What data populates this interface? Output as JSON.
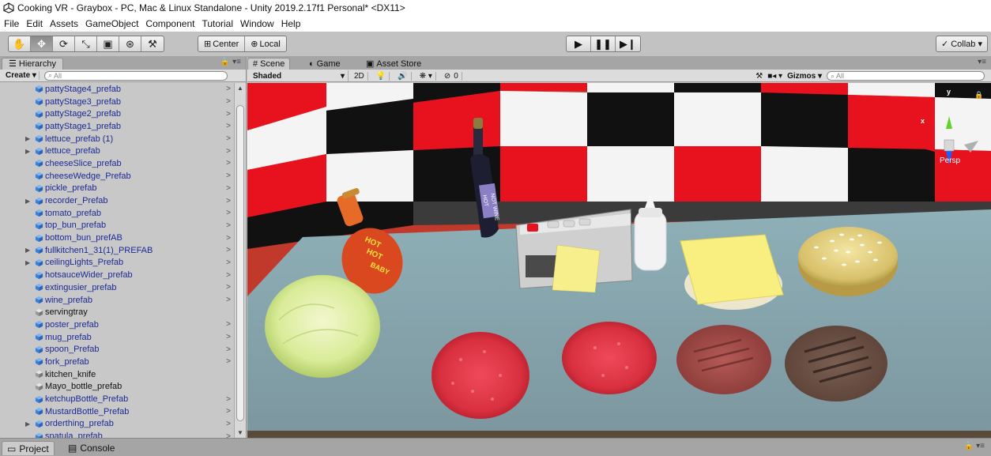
{
  "window": {
    "title": "Cooking VR - Graybox - PC, Mac & Linux Standalone - Unity 2019.2.17f1 Personal* <DX11>"
  },
  "menu": [
    "File",
    "Edit",
    "Assets",
    "GameObject",
    "Component",
    "Tutorial",
    "Window",
    "Help"
  ],
  "toolbar": {
    "tools": [
      "hand-tool",
      "move-tool",
      "rotate-tool",
      "scale-tool",
      "rect-tool",
      "transform-tool",
      "custom-tool"
    ],
    "active_tool": "move-tool",
    "pivot_label": "Center",
    "space_label": "Local",
    "collab_label": "Collab ▾"
  },
  "hierarchy": {
    "tab_label": "Hierarchy",
    "create_label": "Create ▾",
    "search_placeholder": "All",
    "items": [
      {
        "label": "pattyStage4_prefab",
        "expandable": false,
        "chevron": true,
        "prefab": true
      },
      {
        "label": "pattyStage3_prefab",
        "expandable": false,
        "chevron": true,
        "prefab": true
      },
      {
        "label": "pattyStage2_prefab",
        "expandable": false,
        "chevron": true,
        "prefab": true
      },
      {
        "label": "pattyStage1_prefab",
        "expandable": false,
        "chevron": true,
        "prefab": true
      },
      {
        "label": "lettuce_prefab (1)",
        "expandable": true,
        "chevron": true,
        "prefab": true
      },
      {
        "label": "lettuce_prefab",
        "expandable": true,
        "chevron": true,
        "prefab": true
      },
      {
        "label": "cheeseSlice_prefab",
        "expandable": false,
        "chevron": true,
        "prefab": true
      },
      {
        "label": "cheeseWedge_Prefab",
        "expandable": false,
        "chevron": true,
        "prefab": true
      },
      {
        "label": "pickle_prefab",
        "expandable": false,
        "chevron": true,
        "prefab": true
      },
      {
        "label": "recorder_Prefab",
        "expandable": true,
        "chevron": true,
        "prefab": true
      },
      {
        "label": "tomato_prefab",
        "expandable": false,
        "chevron": true,
        "prefab": true
      },
      {
        "label": "top_bun_prefab",
        "expandable": false,
        "chevron": true,
        "prefab": true
      },
      {
        "label": "bottom_bun_prefAB",
        "expandable": false,
        "chevron": true,
        "prefab": true
      },
      {
        "label": "fullkitchen1_31(1)_PREFAB",
        "expandable": true,
        "chevron": true,
        "prefab": true
      },
      {
        "label": "ceilingLights_Prefab",
        "expandable": true,
        "chevron": true,
        "prefab": true
      },
      {
        "label": "hotsauceWider_prefab",
        "expandable": false,
        "chevron": true,
        "prefab": true
      },
      {
        "label": "extingusier_prefab",
        "expandable": false,
        "chevron": true,
        "prefab": true
      },
      {
        "label": "wine_prefab",
        "expandable": false,
        "chevron": true,
        "prefab": true
      },
      {
        "label": "servingtray",
        "expandable": false,
        "chevron": false,
        "prefab": false
      },
      {
        "label": "poster_prefab",
        "expandable": false,
        "chevron": true,
        "prefab": true
      },
      {
        "label": "mug_prefab",
        "expandable": false,
        "chevron": true,
        "prefab": true
      },
      {
        "label": "spoon_Prefab",
        "expandable": false,
        "chevron": true,
        "prefab": true
      },
      {
        "label": "fork_prefab",
        "expandable": false,
        "chevron": true,
        "prefab": true
      },
      {
        "label": "kitchen_knife",
        "expandable": false,
        "chevron": false,
        "prefab": false
      },
      {
        "label": "Mayo_bottle_prefab",
        "expandable": false,
        "chevron": false,
        "prefab": false
      },
      {
        "label": "ketchupBottle_Prefab",
        "expandable": false,
        "chevron": true,
        "prefab": true
      },
      {
        "label": "MustardBottle_Prefab",
        "expandable": false,
        "chevron": true,
        "prefab": true
      },
      {
        "label": "orderthing_prefab",
        "expandable": true,
        "chevron": true,
        "prefab": true
      },
      {
        "label": "spatula_prefab",
        "expandable": false,
        "chevron": true,
        "prefab": true
      }
    ]
  },
  "scene": {
    "tabs": [
      {
        "label": "Scene",
        "icon": "#",
        "active": true
      },
      {
        "label": "Game",
        "icon": "◐",
        "active": false
      },
      {
        "label": "Asset Store",
        "icon": "▣",
        "active": false
      }
    ],
    "shading_mode": "Shaded",
    "toggle_2d": "2D",
    "hidden_count": "0",
    "gizmos_label": "Gizmos",
    "search_placeholder": "All",
    "persp_label": "Persp",
    "gizmo_axes": {
      "y": "y",
      "x": "x"
    },
    "props": {
      "hot_sauce_label": "HOT HOT BABY",
      "wine_label": "HOT NOT WINE"
    }
  },
  "bottom": {
    "tabs": [
      {
        "label": "Project",
        "active": true
      },
      {
        "label": "Console",
        "active": false
      }
    ]
  },
  "colors": {
    "tile_red": "#e8121e",
    "tile_black": "#111111",
    "tile_white": "#f4f4f4",
    "counter": "#8aa5ae",
    "prefab_blue": "#1c2a94"
  }
}
